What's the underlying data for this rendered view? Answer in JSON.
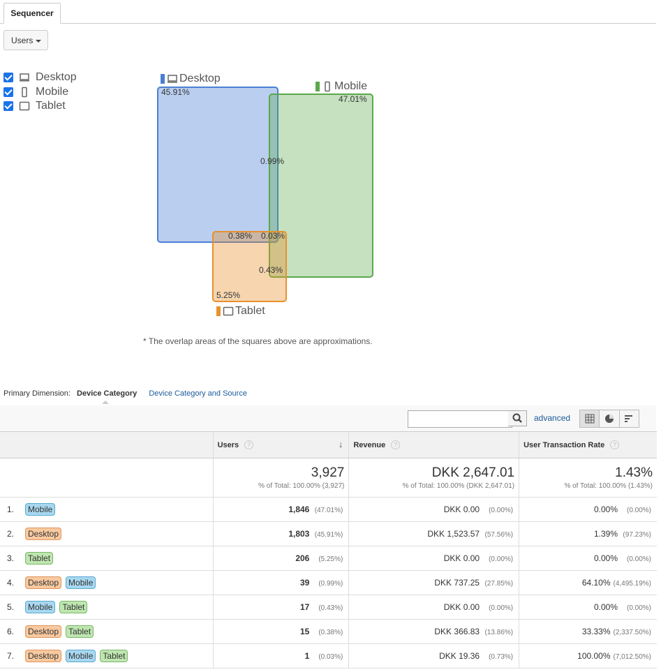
{
  "tabs": [
    {
      "label": "Sequencer"
    }
  ],
  "metric_selector": {
    "value": "Users"
  },
  "devices": [
    {
      "label": "Desktop",
      "icon": "desktop-icon",
      "checked": true
    },
    {
      "label": "Mobile",
      "icon": "mobile-icon",
      "checked": true
    },
    {
      "label": "Tablet",
      "icon": "tablet-icon",
      "checked": true
    }
  ],
  "venn": {
    "desktop": {
      "label": "Desktop",
      "pct": "45.91%",
      "color": "#4a7fd4"
    },
    "mobile": {
      "label": "Mobile",
      "pct": "47.01%",
      "color": "#5aa84a"
    },
    "tablet": {
      "label": "Tablet",
      "pct": "5.25%",
      "color": "#e8902e"
    },
    "desktop_mobile": "0.99%",
    "desktop_tablet": "0.38%",
    "all_three": "0.03%",
    "mobile_tablet": "0.43%",
    "note": "* The overlap areas of the squares above are approximations."
  },
  "dimension": {
    "label": "Primary Dimension:",
    "active": "Device Category",
    "other": "Device Category and Source"
  },
  "toolbar": {
    "search_placeholder": "",
    "advanced": "advanced"
  },
  "table": {
    "headers": {
      "users": "Users",
      "revenue": "Revenue",
      "rate": "User Transaction Rate"
    },
    "totals": {
      "users": "3,927",
      "users_sub": "% of Total: 100.00% (3,927)",
      "revenue": "DKK 2,647.01",
      "revenue_sub": "% of Total: 100.00% (DKK 2,647.01)",
      "rate": "1.43%",
      "rate_sub": "% of Total: 100.00% (1.43%)"
    },
    "rows": [
      {
        "n": "1.",
        "chips": [
          "Mobile"
        ],
        "users": "1,846",
        "users_p": "(47.01%)",
        "rev": "DKK 0.00",
        "rev_p": "(0.00%)",
        "rate": "0.00%",
        "rate_p": "(0.00%)"
      },
      {
        "n": "2.",
        "chips": [
          "Desktop"
        ],
        "users": "1,803",
        "users_p": "(45.91%)",
        "rev": "DKK 1,523.57",
        "rev_p": "(57.56%)",
        "rate": "1.39%",
        "rate_p": "(97.23%)"
      },
      {
        "n": "3.",
        "chips": [
          "Tablet"
        ],
        "users": "206",
        "users_p": "(5.25%)",
        "rev": "DKK 0.00",
        "rev_p": "(0.00%)",
        "rate": "0.00%",
        "rate_p": "(0.00%)"
      },
      {
        "n": "4.",
        "chips": [
          "Desktop",
          "Mobile"
        ],
        "users": "39",
        "users_p": "(0.99%)",
        "rev": "DKK 737.25",
        "rev_p": "(27.85%)",
        "rate": "64.10%",
        "rate_p": "(4,495.19%)"
      },
      {
        "n": "5.",
        "chips": [
          "Mobile",
          "Tablet"
        ],
        "users": "17",
        "users_p": "(0.43%)",
        "rev": "DKK 0.00",
        "rev_p": "(0.00%)",
        "rate": "0.00%",
        "rate_p": "(0.00%)"
      },
      {
        "n": "6.",
        "chips": [
          "Desktop",
          "Tablet"
        ],
        "users": "15",
        "users_p": "(0.38%)",
        "rev": "DKK 366.83",
        "rev_p": "(13.86%)",
        "rate": "33.33%",
        "rate_p": "(2,337.50%)"
      },
      {
        "n": "7.",
        "chips": [
          "Desktop",
          "Mobile",
          "Tablet"
        ],
        "users": "1",
        "users_p": "(0.03%)",
        "rev": "DKK 19.36",
        "rev_p": "(0.73%)",
        "rate": "100.00%",
        "rate_p": "(7,012.50%)"
      }
    ]
  }
}
